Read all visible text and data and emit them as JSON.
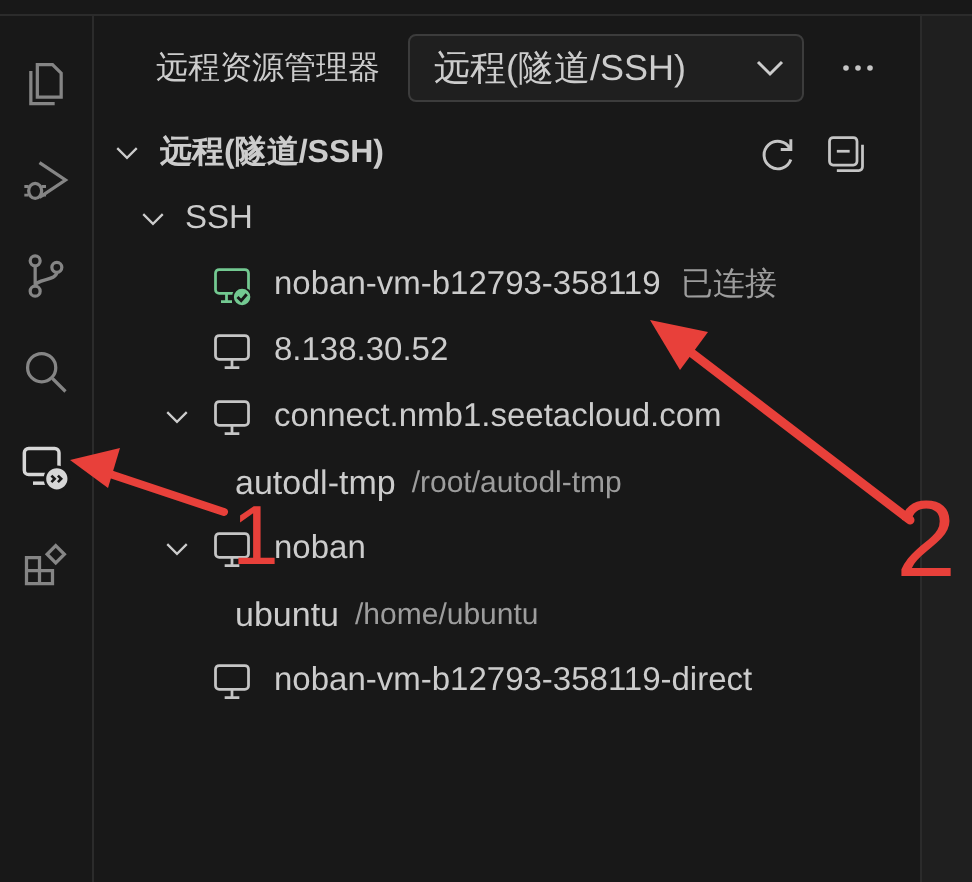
{
  "activity_bar": {
    "items": [
      {
        "kind": "files",
        "selected": false
      },
      {
        "kind": "debug",
        "selected": false
      },
      {
        "kind": "git",
        "selected": false
      },
      {
        "kind": "search",
        "selected": false
      },
      {
        "kind": "remote",
        "selected": true
      },
      {
        "kind": "extensions",
        "selected": false
      }
    ]
  },
  "explorer": {
    "title": "远程资源管理器",
    "dropdown": {
      "value": "远程(隧道/SSH)"
    },
    "section": {
      "label": "远程(隧道/SSH)",
      "expanded": true,
      "children": [
        {
          "kind": "group",
          "label": "SSH",
          "expanded": true,
          "children": [
            {
              "kind": "host",
              "label": "noban-vm-b12793-358119",
              "connected": true,
              "status": "已连接"
            },
            {
              "kind": "host",
              "label": "8.138.30.52",
              "connected": false
            },
            {
              "kind": "host",
              "label": "connect.nmb1.seetacloud.com",
              "connected": false,
              "expanded": true,
              "children": [
                {
                  "kind": "folder",
                  "label": "autodl-tmp",
                  "path": "/root/autodl-tmp"
                }
              ]
            },
            {
              "kind": "host",
              "label": "noban",
              "connected": false,
              "expanded": true,
              "children": [
                {
                  "kind": "folder",
                  "label": "ubuntu",
                  "path": "/home/ubuntu"
                }
              ]
            },
            {
              "kind": "host",
              "label": "noban-vm-b12793-358119-direct",
              "connected": false
            }
          ]
        }
      ]
    }
  },
  "annotations": [
    {
      "label": "1"
    },
    {
      "label": "2"
    }
  ]
}
